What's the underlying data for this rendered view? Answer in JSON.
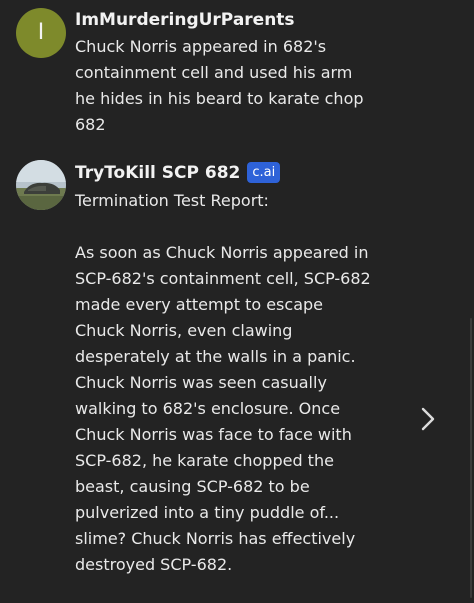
{
  "messages": {
    "user": {
      "avatar_letter": "I",
      "sender": "ImMurderingUrParents",
      "text": "Chuck Norris appeared in 682's containment cell and used his arm he hides in his beard to karate chop 682"
    },
    "bot": {
      "sender": "TryToKill SCP 682",
      "badge": "c.ai",
      "paragraphs": [
        "Termination Test Report:",
        "As soon as Chuck Norris appeared in SCP-682's containment cell, SCP-682 made every attempt to escape Chuck Norris, even clawing desperately at the walls in a panic. Chuck Norris was seen casually walking to 682's enclosure. Once Chuck Norris was face to face with SCP-682, he karate chopped the beast, causing SCP-682 to be pulverized into a tiny puddle of... slime? Chuck Norris has effectively destroyed SCP-682."
      ]
    }
  },
  "icons": {
    "next_swipe": "chevron-right-icon"
  },
  "colors": {
    "background": "#232323",
    "text": "#e9e9e9",
    "avatar_letter_bg": "#7e8a2b",
    "badge_bg": "#2e62d8"
  }
}
